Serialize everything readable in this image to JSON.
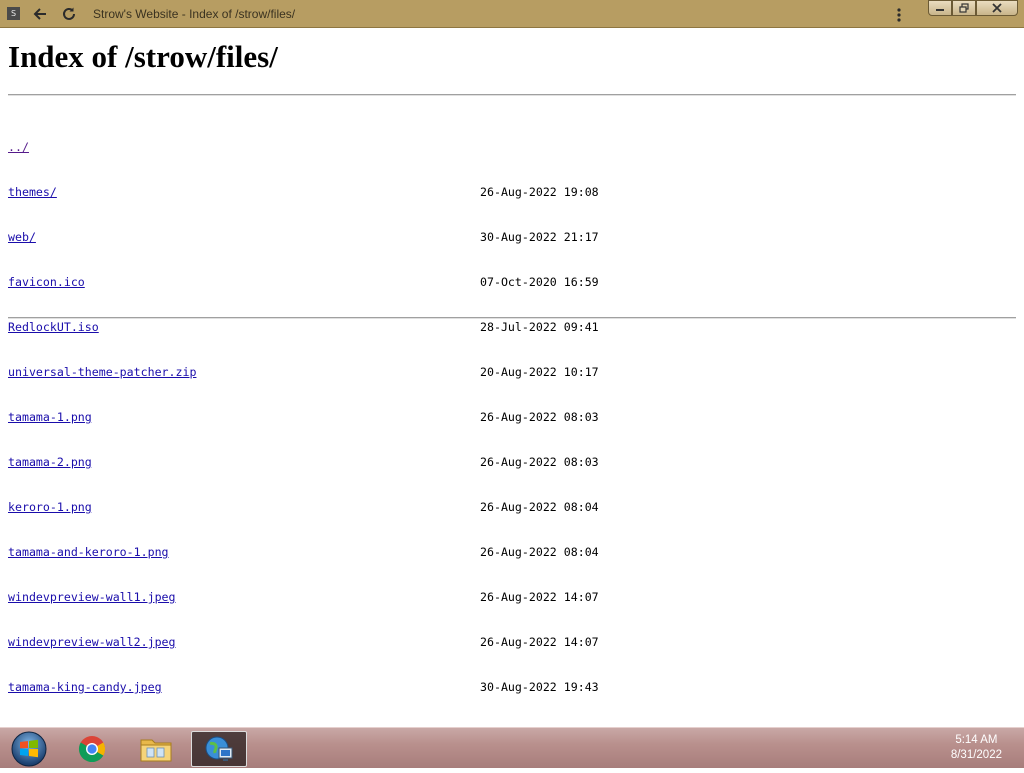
{
  "browser": {
    "tab_title": "Strow's Website - Index of /strow/files/",
    "favicon_letter": "S"
  },
  "page": {
    "heading": "Index of /strow/files/",
    "entries": [
      {
        "name": "../",
        "date": ""
      },
      {
        "name": "themes/",
        "date": "26-Aug-2022 19:08"
      },
      {
        "name": "web/",
        "date": "30-Aug-2022 21:17"
      },
      {
        "name": "favicon.ico",
        "date": "07-Oct-2020 16:59"
      },
      {
        "name": "RedlockUT.iso",
        "date": "28-Jul-2022 09:41"
      },
      {
        "name": "universal-theme-patcher.zip",
        "date": "20-Aug-2022 10:17"
      },
      {
        "name": "tamama-1.png",
        "date": "26-Aug-2022 08:03"
      },
      {
        "name": "tamama-2.png",
        "date": "26-Aug-2022 08:03"
      },
      {
        "name": "keroro-1.png",
        "date": "26-Aug-2022 08:04"
      },
      {
        "name": "tamama-and-keroro-1.png",
        "date": "26-Aug-2022 08:04"
      },
      {
        "name": "windevpreview-wall1.jpeg",
        "date": "26-Aug-2022 14:07"
      },
      {
        "name": "windevpreview-wall2.jpeg",
        "date": "26-Aug-2022 14:07"
      },
      {
        "name": "tamama-king-candy.jpeg",
        "date": "30-Aug-2022 19:43"
      }
    ]
  },
  "taskbar": {
    "apps": [
      "chrome-icon",
      "file-explorer-icon",
      "network-globe-icon"
    ],
    "time": "5:14 AM",
    "date": "8/31/2022"
  },
  "colors": {
    "titlebar": "#b79d62",
    "link": "#1a0dab",
    "visited_link": "#551a8b"
  }
}
